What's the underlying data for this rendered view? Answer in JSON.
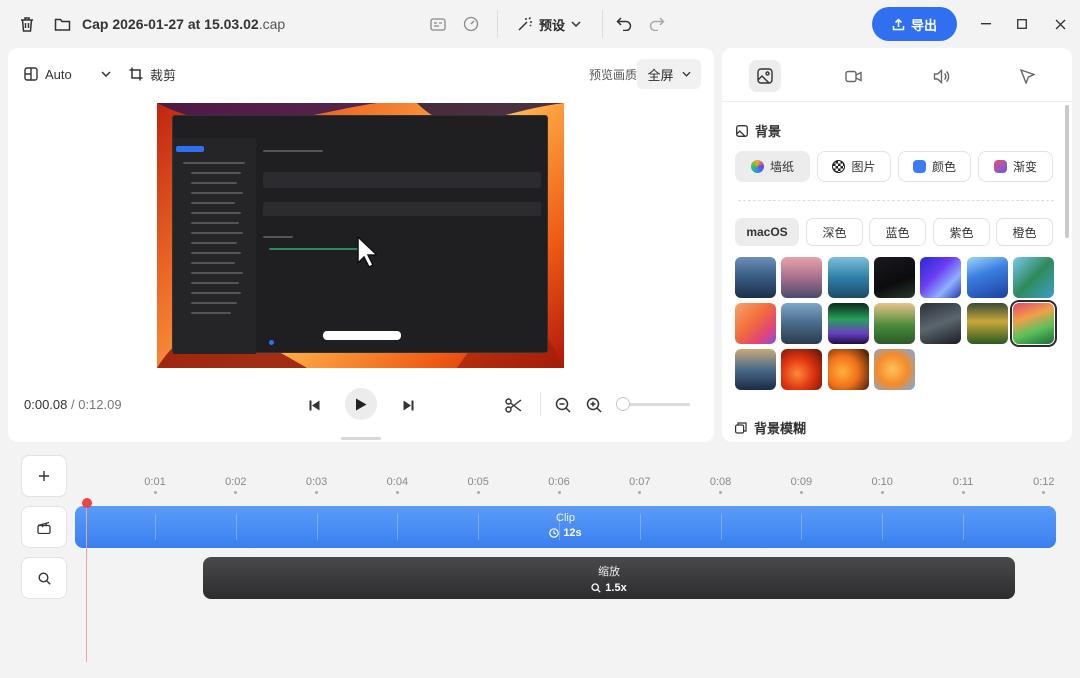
{
  "titlebar": {
    "filename": "Cap 2026-01-27 at 15.03.02",
    "extension": ".cap",
    "preset_label": "预设",
    "export_label": "导出"
  },
  "toolbar": {
    "layout_label": "Auto",
    "crop_label": "裁剪",
    "quality_caption": "预览画质",
    "quality_value": "全屏"
  },
  "playback": {
    "current_time": "0:00.08",
    "separator": " / ",
    "total_time": "0:12.09"
  },
  "sidebar": {
    "background_title": "背景",
    "bg_types": [
      {
        "label": "墙纸"
      },
      {
        "label": "图片"
      },
      {
        "label": "颜色"
      },
      {
        "label": "渐变"
      }
    ],
    "categories": [
      {
        "label": "macOS"
      },
      {
        "label": "深色"
      },
      {
        "label": "蓝色"
      },
      {
        "label": "紫色"
      },
      {
        "label": "橙色"
      }
    ],
    "blur_title": "背景模糊",
    "selected_wallpaper_index": 13
  },
  "timeline": {
    "ticks": [
      "0:01",
      "0:02",
      "0:03",
      "0:04",
      "0:05",
      "0:06",
      "0:07",
      "0:08",
      "0:09",
      "0:10",
      "0:11",
      "0:12"
    ],
    "clip_label": "Clip",
    "clip_duration": "12s",
    "zoom_label": "缩放",
    "zoom_value": "1.5x"
  },
  "colors": {
    "accent": "#2f6ff0",
    "clip": "#3a7ff0",
    "playhead": "#e84545"
  }
}
